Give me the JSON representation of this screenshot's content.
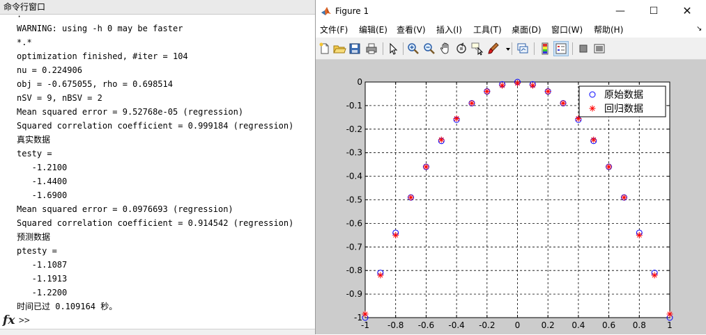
{
  "command_window": {
    "title": "命令行窗口",
    "lines": [
      "·",
      "WARNING: using -h 0 may be faster",
      "*.*",
      "optimization finished, #iter = 104",
      "nu = 0.224906",
      "obj = -0.675055, rho = 0.698514",
      "nSV = 9, nBSV = 2",
      "Mean squared error = 9.52768e-05 (regression)",
      "Squared correlation coefficient = 0.999184 (regression)",
      "真实数据",
      "testy =",
      "   -1.2100",
      "   -1.4400",
      "   -1.6900",
      "Mean squared error = 0.0976693 (regression)",
      "Squared correlation coefficient = 0.914542 (regression)",
      "预测数据",
      "ptesty =",
      "   -1.1087",
      "   -1.1913",
      "   -1.2200",
      "时间已过 0.109164 秒。"
    ],
    "fx_label": "fx",
    "prompt": ">>"
  },
  "figure": {
    "title": "Figure 1",
    "window_controls": {
      "minimize": "—",
      "maximize": "☐",
      "close": "✕"
    },
    "menus": [
      "文件(F)",
      "编辑(E)",
      "查看(V)",
      "插入(I)",
      "工具(T)",
      "桌面(D)",
      "窗口(W)",
      "帮助(H)"
    ],
    "toolbar_icons": [
      "new-figure-icon",
      "open-file-icon",
      "save-icon",
      "print-icon",
      "edit-plot-icon",
      "zoom-in-icon",
      "zoom-out-icon",
      "pan-icon",
      "rotate-3d-icon",
      "data-cursor-icon",
      "brush-icon",
      "link-plot-icon",
      "colorbar-icon",
      "legend-icon",
      "hide-plot-tools-icon",
      "show-plot-tools-icon"
    ],
    "accent_colors": {
      "marker_original": "#0000ff",
      "marker_regression": "#ff0000"
    }
  },
  "chart_data": {
    "type": "scatter",
    "title": "",
    "xlabel": "",
    "ylabel": "",
    "xlim": [
      -1,
      1
    ],
    "ylim": [
      -1,
      0
    ],
    "xticks": [
      "-1",
      "-0.8",
      "-0.6",
      "-0.4",
      "-0.2",
      "0",
      "0.2",
      "0.4",
      "0.6",
      "0.8",
      "1"
    ],
    "yticks": [
      "0",
      "-0.1",
      "-0.2",
      "-0.3",
      "-0.4",
      "-0.5",
      "-0.6",
      "-0.7",
      "-0.8",
      "-0.9",
      "-1"
    ],
    "grid": true,
    "legend_position": "top-right",
    "series": [
      {
        "name": "原始数据",
        "marker": "circle",
        "color": "#0000ff",
        "x": [
          -1,
          -0.9,
          -0.8,
          -0.7,
          -0.6,
          -0.5,
          -0.4,
          -0.3,
          -0.2,
          -0.1,
          0,
          0.1,
          0.2,
          0.3,
          0.4,
          0.5,
          0.6,
          0.7,
          0.8,
          0.9,
          1
        ],
        "y": [
          -1,
          -0.81,
          -0.64,
          -0.49,
          -0.36,
          -0.25,
          -0.16,
          -0.09,
          -0.04,
          -0.01,
          0,
          -0.01,
          -0.04,
          -0.09,
          -0.16,
          -0.25,
          -0.36,
          -0.49,
          -0.64,
          -0.81,
          -1
        ]
      },
      {
        "name": "回归数据",
        "marker": "star",
        "color": "#ff0000",
        "x": [
          -1,
          -0.9,
          -0.8,
          -0.7,
          -0.6,
          -0.5,
          -0.4,
          -0.3,
          -0.2,
          -0.1,
          0,
          0.1,
          0.2,
          0.3,
          0.4,
          0.5,
          0.6,
          0.7,
          0.8,
          0.9,
          1
        ],
        "y": [
          -0.985,
          -0.82,
          -0.65,
          -0.49,
          -0.36,
          -0.245,
          -0.155,
          -0.09,
          -0.04,
          -0.015,
          -0.005,
          -0.015,
          -0.04,
          -0.09,
          -0.155,
          -0.245,
          -0.36,
          -0.49,
          -0.65,
          -0.82,
          -0.985
        ]
      }
    ]
  }
}
